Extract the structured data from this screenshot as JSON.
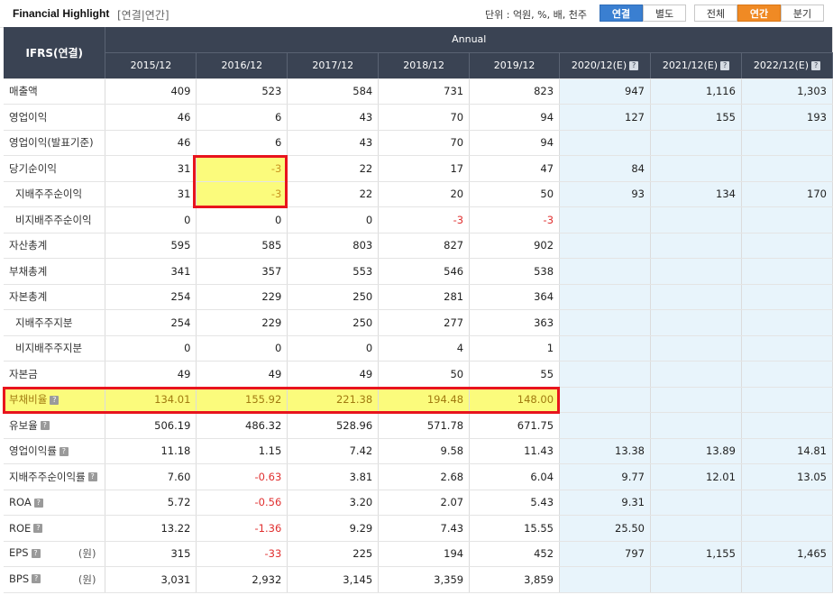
{
  "header": {
    "title": "Financial Highlight",
    "subtitle": "[연결|연간]",
    "unit": "단위 : 억원, %, 배, 천주",
    "toggle_consolidated": "연결",
    "toggle_separate": "별도",
    "period_all": "전체",
    "period_annual": "연간",
    "period_quarter": "분기"
  },
  "table": {
    "corner": "IFRS(연결)",
    "group": "Annual",
    "columns": [
      "2015/12",
      "2016/12",
      "2017/12",
      "2018/12",
      "2019/12",
      "2020/12(E)",
      "2021/12(E)",
      "2022/12(E)"
    ],
    "rows": [
      {
        "label": "매출액",
        "values": [
          "409",
          "523",
          "584",
          "731",
          "823",
          "947",
          "1,116",
          "1,303"
        ]
      },
      {
        "label": "영업이익",
        "values": [
          "46",
          "6",
          "43",
          "70",
          "94",
          "127",
          "155",
          "193"
        ]
      },
      {
        "label": "영업이익(발표기준)",
        "values": [
          "46",
          "6",
          "43",
          "70",
          "94",
          "",
          "",
          ""
        ]
      },
      {
        "label": "당기순이익",
        "values": [
          "31",
          "-3",
          "22",
          "17",
          "47",
          "84",
          "",
          ""
        ]
      },
      {
        "label": "지배주주순이익",
        "values": [
          "31",
          "-3",
          "22",
          "20",
          "50",
          "93",
          "134",
          "170"
        ]
      },
      {
        "label": "비지배주주순이익",
        "values": [
          "0",
          "0",
          "0",
          "-3",
          "-3",
          "",
          "",
          ""
        ]
      },
      {
        "label": "자산총계",
        "values": [
          "595",
          "585",
          "803",
          "827",
          "902",
          "",
          "",
          ""
        ]
      },
      {
        "label": "부채총계",
        "values": [
          "341",
          "357",
          "553",
          "546",
          "538",
          "",
          "",
          ""
        ]
      },
      {
        "label": "자본총계",
        "values": [
          "254",
          "229",
          "250",
          "281",
          "364",
          "",
          "",
          ""
        ]
      },
      {
        "label": "지배주주지분",
        "values": [
          "254",
          "229",
          "250",
          "277",
          "363",
          "",
          "",
          ""
        ]
      },
      {
        "label": "비지배주주지분",
        "values": [
          "0",
          "0",
          "0",
          "4",
          "1",
          "",
          "",
          ""
        ]
      },
      {
        "label": "자본금",
        "values": [
          "49",
          "49",
          "49",
          "50",
          "55",
          "",
          "",
          ""
        ]
      },
      {
        "label": "부채비율",
        "values": [
          "134.01",
          "155.92",
          "221.38",
          "194.48",
          "148.00",
          "",
          "",
          ""
        ]
      },
      {
        "label": "유보율",
        "values": [
          "506.19",
          "486.32",
          "528.96",
          "571.78",
          "671.75",
          "",
          "",
          ""
        ]
      },
      {
        "label": "영업이익률",
        "values": [
          "11.18",
          "1.15",
          "7.42",
          "9.58",
          "11.43",
          "13.38",
          "13.89",
          "14.81"
        ]
      },
      {
        "label": "지배주주순이익률",
        "values": [
          "7.60",
          "-0.63",
          "3.81",
          "2.68",
          "6.04",
          "9.77",
          "12.01",
          "13.05"
        ]
      },
      {
        "label": "ROA",
        "values": [
          "5.72",
          "-0.56",
          "3.20",
          "2.07",
          "5.43",
          "9.31",
          "",
          ""
        ]
      },
      {
        "label": "ROE",
        "values": [
          "13.22",
          "-1.36",
          "9.29",
          "7.43",
          "15.55",
          "25.50",
          "",
          ""
        ]
      },
      {
        "label": "EPS",
        "unit": "(원)",
        "values": [
          "315",
          "-33",
          "225",
          "194",
          "452",
          "797",
          "1,155",
          "1,465"
        ]
      },
      {
        "label": "BPS",
        "unit": "(원)",
        "values": [
          "3,031",
          "2,932",
          "3,145",
          "3,359",
          "3,859",
          "",
          "",
          ""
        ]
      }
    ]
  }
}
